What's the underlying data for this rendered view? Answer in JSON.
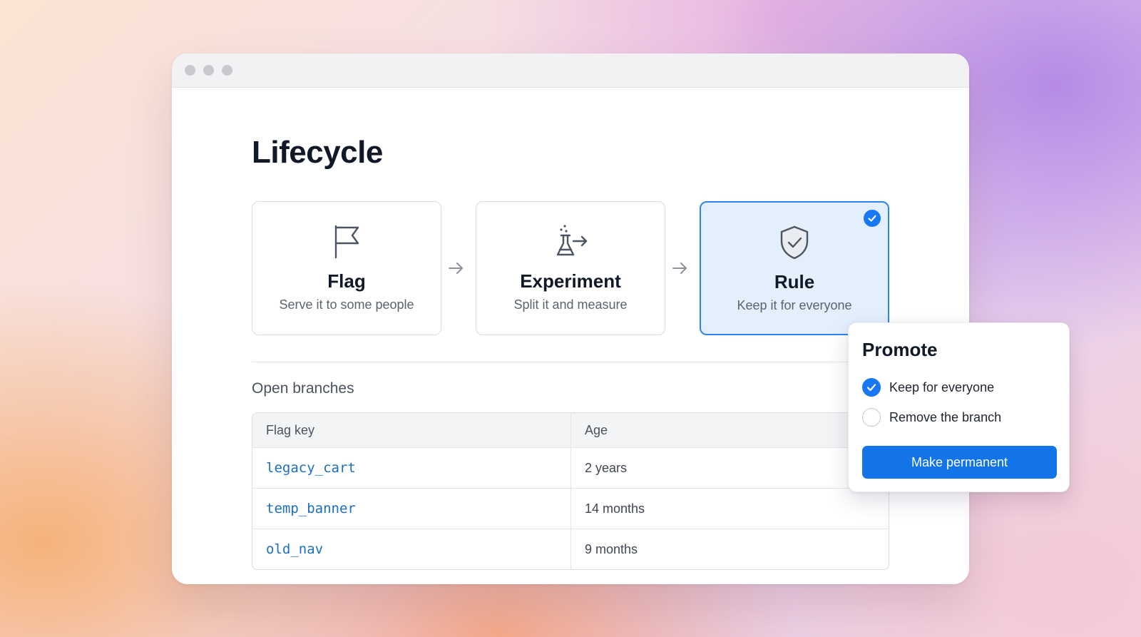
{
  "page": {
    "title": "Lifecycle"
  },
  "stages": [
    {
      "name": "Flag",
      "description": "Serve it to some people",
      "icon": "flag-icon",
      "selected": false
    },
    {
      "name": "Experiment",
      "description": "Split it and measure",
      "icon": "flask-arrow-icon",
      "selected": false
    },
    {
      "name": "Rule",
      "description": "Keep it for everyone",
      "icon": "shield-check-icon",
      "selected": true
    }
  ],
  "branches": {
    "label": "Open branches",
    "columns": [
      "Flag key",
      "Age"
    ],
    "rows": [
      {
        "key": "legacy_cart",
        "age": "2 years"
      },
      {
        "key": "temp_banner",
        "age": "14 months"
      },
      {
        "key": "old_nav",
        "age": "9 months"
      }
    ]
  },
  "promote": {
    "title": "Promote",
    "options": [
      {
        "label": "Keep for everyone",
        "checked": true
      },
      {
        "label": "Remove the branch",
        "checked": false
      }
    ],
    "button_label": "Make permanent"
  },
  "colors": {
    "accent": "#1877f2",
    "selected_card_bg": "#e3effd",
    "code_text": "#1a6fc4"
  }
}
